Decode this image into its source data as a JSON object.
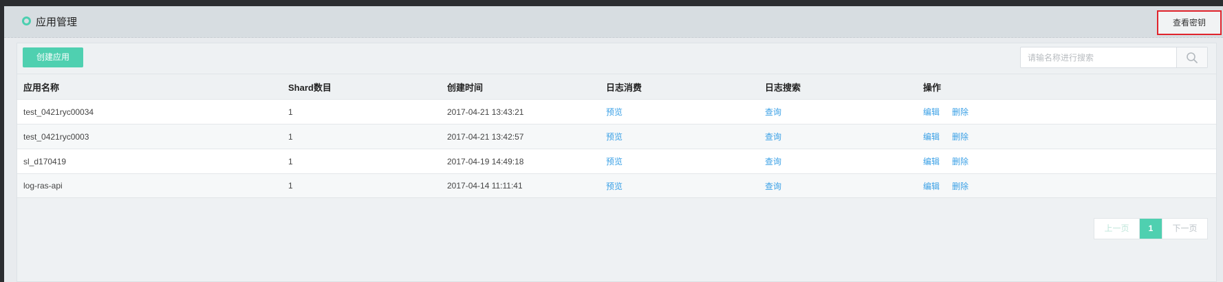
{
  "header": {
    "title": "应用管理",
    "view_key_label": "查看密钥"
  },
  "toolbar": {
    "create_label": "创建应用",
    "search_placeholder": "请输名称进行搜索"
  },
  "table": {
    "columns": [
      "应用名称",
      "Shard数目",
      "创建时间",
      "日志消费",
      "日志搜索",
      "操作"
    ],
    "rows": [
      {
        "name": "test_0421ryc00034",
        "shards": "1",
        "created": "2017-04-21 13:43:21",
        "consume": "预览",
        "search": "查询",
        "edit": "编辑",
        "delete": "删除"
      },
      {
        "name": "test_0421ryc0003",
        "shards": "1",
        "created": "2017-04-21 13:42:57",
        "consume": "预览",
        "search": "查询",
        "edit": "编辑",
        "delete": "删除"
      },
      {
        "name": "sl_d170419",
        "shards": "1",
        "created": "2017-04-19 14:49:18",
        "consume": "预览",
        "search": "查询",
        "edit": "编辑",
        "delete": "删除"
      },
      {
        "name": "log-ras-api",
        "shards": "1",
        "created": "2017-04-14 11:11:41",
        "consume": "预览",
        "search": "查询",
        "edit": "编辑",
        "delete": "删除"
      }
    ]
  },
  "pagination": {
    "prev_label": "上一页",
    "current_page": "1",
    "next_label": "下一页"
  },
  "colors": {
    "accent": "#4fd0b0",
    "link": "#3aa0e6",
    "highlight_border": "#e0232b"
  }
}
